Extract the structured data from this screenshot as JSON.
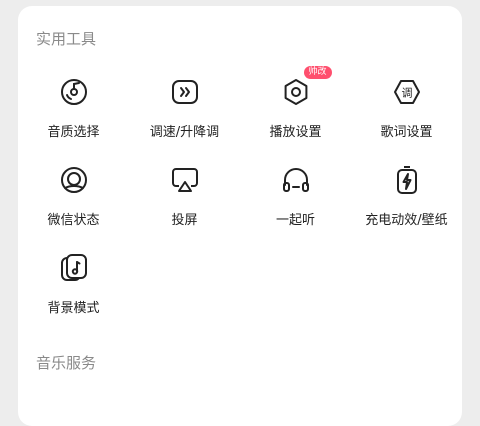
{
  "sections": {
    "tools_title": "实用工具",
    "music_title": "音乐服务"
  },
  "tools": [
    {
      "label": "音质选择",
      "icon": "vinyl-disc-icon"
    },
    {
      "label": "调速/升降调",
      "icon": "speed-icon"
    },
    {
      "label": "播放设置",
      "icon": "hexagon-settings-icon",
      "badge": "帅改"
    },
    {
      "label": "歌词设置",
      "icon": "lyrics-icon"
    },
    {
      "label": "微信状态",
      "icon": "wechat-status-icon"
    },
    {
      "label": "投屏",
      "icon": "cast-icon"
    },
    {
      "label": "一起听",
      "icon": "headphones-icon"
    },
    {
      "label": "充电动效/壁纸",
      "icon": "charging-icon"
    },
    {
      "label": "背景模式",
      "icon": "background-mode-icon"
    }
  ],
  "colors": {
    "accent": "#ff4f6e",
    "text": "#222222",
    "muted": "#8a8a8a"
  }
}
